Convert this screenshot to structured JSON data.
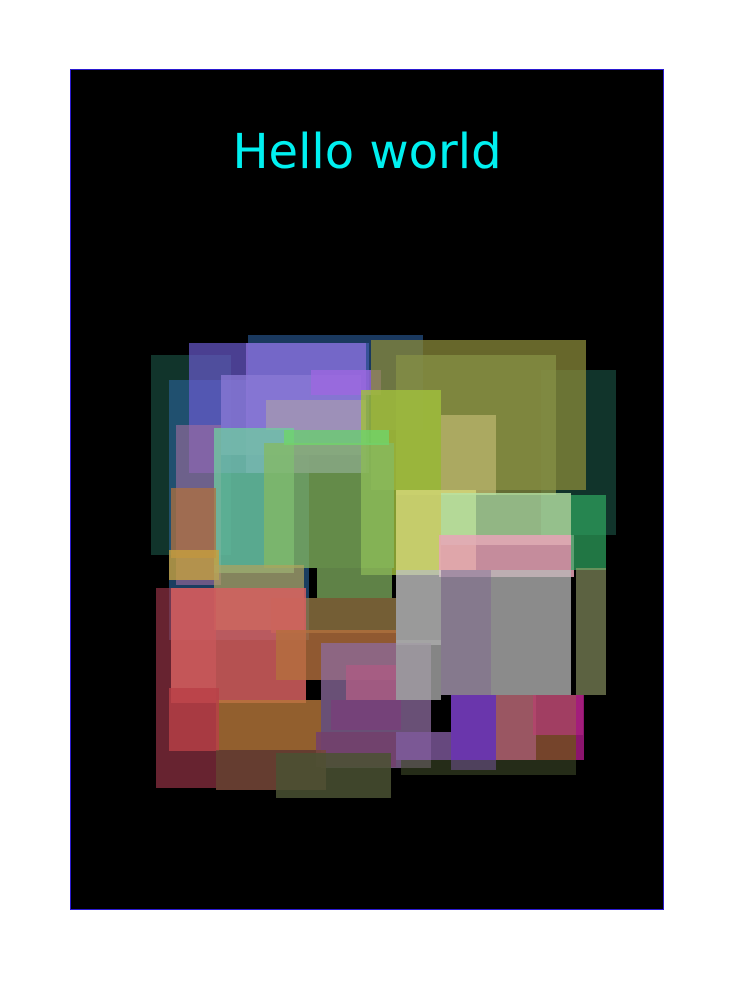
{
  "heading": "Hello world",
  "colors": {
    "page_background": "#ffffff",
    "canvas_background": "#000000",
    "canvas_border": "#2a1ad0",
    "heading": "#00f0f0"
  }
}
